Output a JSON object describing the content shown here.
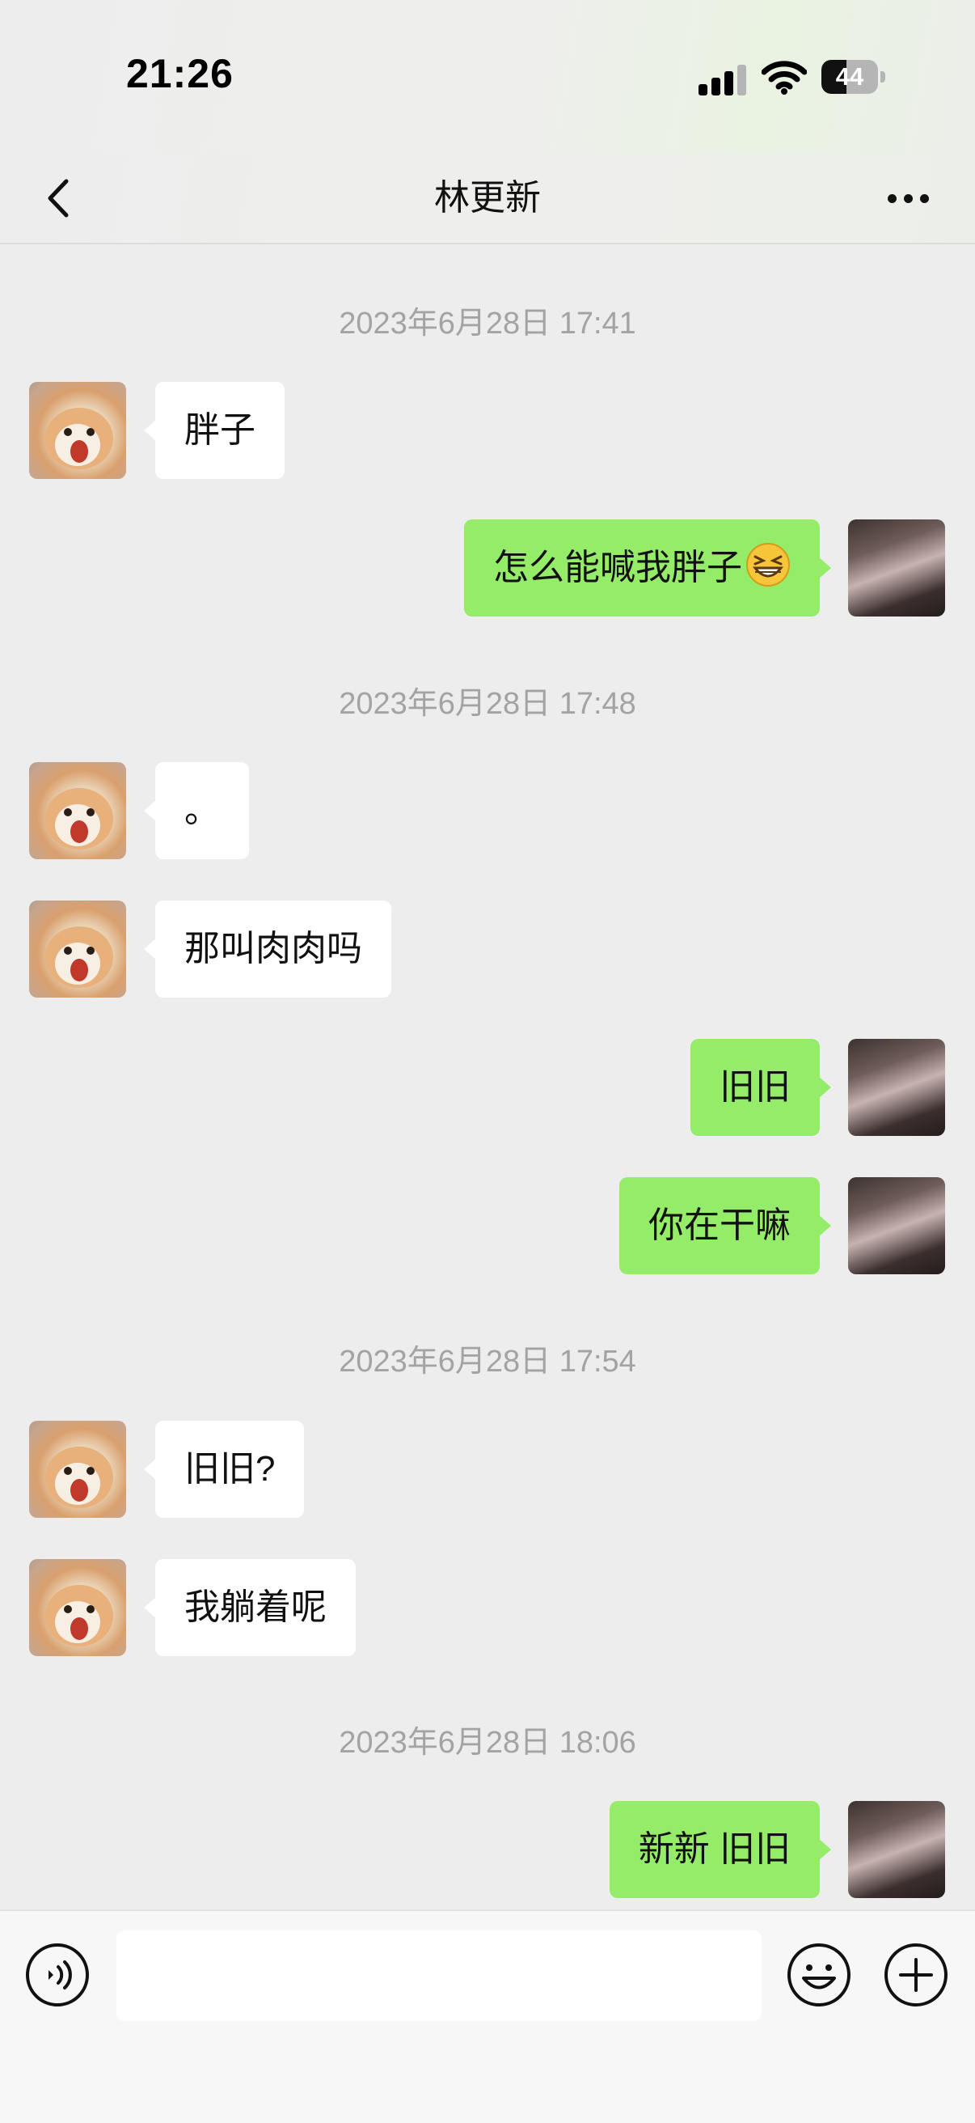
{
  "status_bar": {
    "time": "21:26",
    "battery": "44",
    "battery_level": 0.44
  },
  "nav": {
    "title": "林更新"
  },
  "messages": [
    {
      "type": "timestamp",
      "text": "2023年6月28日 17:41"
    },
    {
      "type": "in",
      "text": "胖子"
    },
    {
      "type": "out",
      "text": "怎么能喊我胖子",
      "emoji": "grinning-squinting-face"
    },
    {
      "type": "timestamp",
      "text": "2023年6月28日 17:48"
    },
    {
      "type": "in",
      "text": "。"
    },
    {
      "type": "in",
      "text": "那叫肉肉吗"
    },
    {
      "type": "out",
      "text": "旧旧"
    },
    {
      "type": "out",
      "text": "你在干嘛"
    },
    {
      "type": "timestamp",
      "text": "2023年6月28日 17:54"
    },
    {
      "type": "in",
      "text": "旧旧?"
    },
    {
      "type": "in",
      "text": "我躺着呢"
    },
    {
      "type": "timestamp",
      "text": "2023年6月28日 18:06"
    },
    {
      "type": "out",
      "text": "新新 旧旧"
    }
  ],
  "input": {
    "value": "",
    "placeholder": ""
  },
  "icons": {
    "back": "chevron-left-icon",
    "more": "more-dots-icon",
    "voice": "voice-icon",
    "emoji": "emoji-icon",
    "plus": "plus-icon"
  },
  "colors": {
    "background": "#ededed",
    "outgoing_bubble": "#95ec69",
    "incoming_bubble": "#ffffff",
    "timestamp_text": "#a3a3a3"
  }
}
